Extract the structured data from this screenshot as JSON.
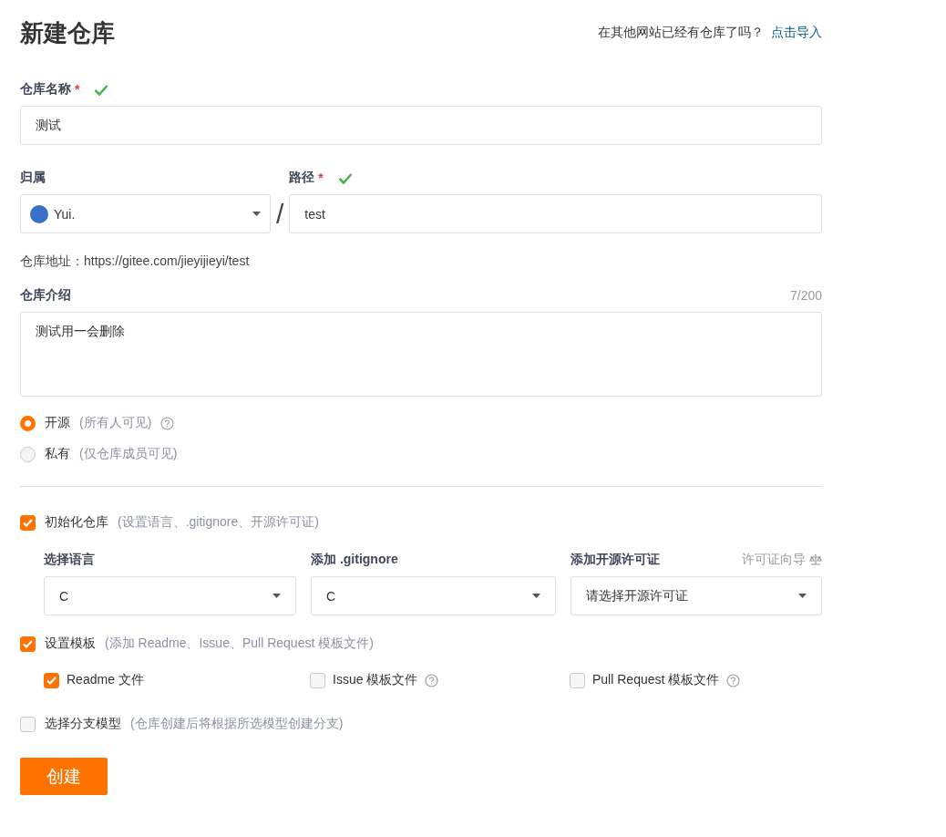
{
  "header": {
    "title": "新建仓库",
    "import_prompt": "在其他网站已经有仓库了吗？",
    "import_link": "点击导入"
  },
  "name_field": {
    "label": "仓库名称",
    "required_mark": "*",
    "valid": true,
    "value": "测试"
  },
  "owner_field": {
    "label": "归属",
    "value": "Yui."
  },
  "separator": "/",
  "path_field": {
    "label": "路径",
    "required_mark": "*",
    "valid": true,
    "value": "test"
  },
  "address": "仓库地址：https://gitee.com/jieyijieyi/test",
  "description": {
    "label": "仓库介绍",
    "counter": "7/200",
    "value": "测试用一会删除"
  },
  "visibility": [
    {
      "label": "开源",
      "hint": "(所有人可见)",
      "selected": true,
      "help": true
    },
    {
      "label": "私有",
      "hint": "(仅仓库成员可见)",
      "selected": false,
      "help": false
    }
  ],
  "init": {
    "label": "初始化仓库",
    "hint": "(设置语言、.gitignore、开源许可证)",
    "checked": true,
    "selects": [
      {
        "label": "选择语言",
        "value": "C"
      },
      {
        "label": "添加 .gitignore",
        "value": "C"
      },
      {
        "label": "添加开源许可证",
        "value": "请选择开源许可证",
        "link": "许可证向导"
      }
    ]
  },
  "template": {
    "label": "设置模板",
    "hint": "(添加 Readme、Issue、Pull Request 模板文件)",
    "checked": true,
    "options": [
      {
        "label": "Readme 文件",
        "checked": true,
        "help": false
      },
      {
        "label": "Issue 模板文件",
        "checked": false,
        "help": true
      },
      {
        "label": "Pull Request 模板文件",
        "checked": false,
        "help": true
      }
    ]
  },
  "branch": {
    "label": "选择分支模型",
    "hint": "(仓库创建后将根据所选模型创建分支)",
    "checked": false
  },
  "submit": "创建"
}
